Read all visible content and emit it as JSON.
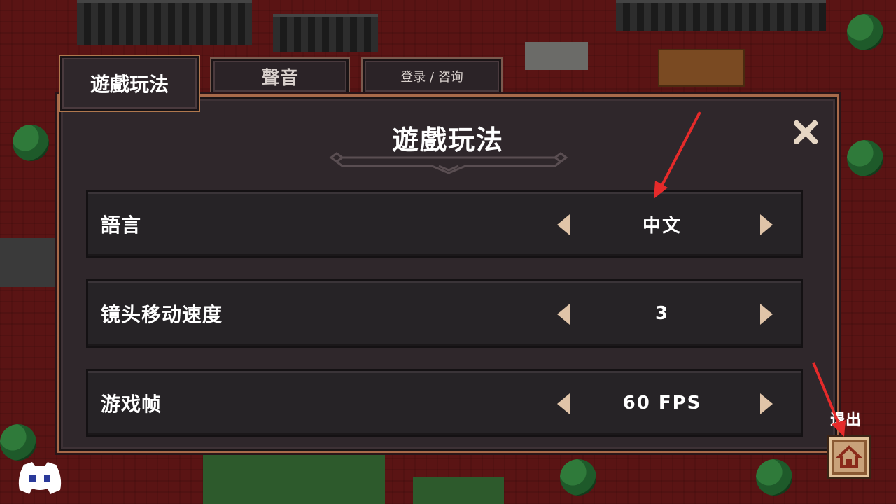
{
  "tabs": [
    {
      "label": "遊戲玩法",
      "active": true
    },
    {
      "label": "聲音",
      "active": false
    },
    {
      "label": "登录 / 咨询",
      "active": false
    }
  ],
  "panel": {
    "title": "遊戲玩法",
    "close_icon": "close-icon"
  },
  "settings": [
    {
      "label": "語言",
      "value": "中文"
    },
    {
      "label": "镜头移动速度",
      "value": "3"
    },
    {
      "label": "游戏帧",
      "value": "60 FPS"
    }
  ],
  "exit": {
    "label": "退出",
    "icon": "home-icon"
  },
  "discord_icon": "discord-icon",
  "colors": {
    "panel_bg": "#2f272b",
    "row_bg": "#262326",
    "border_accent": "#a86a4a",
    "arrow": "#e0c4a8",
    "annotation": "#e52a2a",
    "exit_button": "#c9a27a"
  }
}
